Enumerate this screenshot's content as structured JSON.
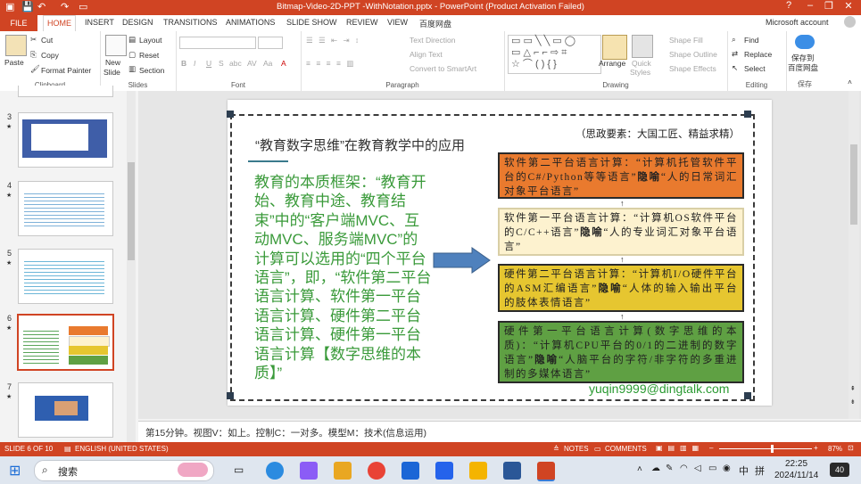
{
  "title_bar": {
    "document_title": "Bitmap-Video-2D-PPT -WithNotation.pptx - PowerPoint (Product Activation Failed)",
    "help": "?",
    "minimize": "–",
    "restore": "❐",
    "close": "✕"
  },
  "ribbon_tabs": [
    "FILE",
    "HOME",
    "INSERT",
    "DESIGN",
    "TRANSITIONS",
    "ANIMATIONS",
    "SLIDE SHOW",
    "REVIEW",
    "VIEW",
    "百度网盘"
  ],
  "account": "Microsoft account",
  "clipboard": {
    "paste": "Paste",
    "cut": "Cut",
    "copy": "Copy",
    "format_painter": "Format Painter",
    "label": "Clipboard"
  },
  "slides_group": {
    "new_slide": "New",
    "new_slide2": "Slide",
    "layout": "Layout",
    "reset": "Reset",
    "section": "Section",
    "label": "Slides"
  },
  "font_group": {
    "bold": "B",
    "italic": "I",
    "underline": "U",
    "strike": "S",
    "shadow": "abc",
    "spacing": "AV",
    "case": "Aa",
    "color": "A",
    "label": "Font"
  },
  "paragraph_group": {
    "text_direction": "Text Direction",
    "align_text": "Align Text",
    "smartart": "Convert to SmartArt",
    "label": "Paragraph"
  },
  "drawing_group": {
    "arrange": "Arrange",
    "quick": "Quick",
    "styles": "Styles",
    "shape_fill": "Shape Fill",
    "shape_outline": "Shape Outline",
    "shape_effects": "Shape Effects",
    "label": "Drawing"
  },
  "editing_group": {
    "find": "Find",
    "replace": "Replace",
    "select": "Select",
    "label": "Editing"
  },
  "save_group": {
    "line1": "保存到",
    "line2": "百度网盘",
    "label": "保存"
  },
  "thumbnails": [
    {
      "num": "3",
      "star": "★"
    },
    {
      "num": "4",
      "star": "★"
    },
    {
      "num": "5",
      "star": "★"
    },
    {
      "num": "6",
      "star": "★"
    },
    {
      "num": "7",
      "star": "★"
    }
  ],
  "slide": {
    "title": "“教育数字思维”在教育教学中的应用",
    "tag": "（思政要素：大国工匠、精益求精）",
    "main_text": "教育的本质框架：“教育开始、教育中途、教育结束”中的“客户端MVC、互动MVC、服务端MVC”的计算可以选用的“四个平台语言”，即，“软件第二平台语言计算、软件第一平台语言计算、硬件第二平台语言计算、硬件第一平台语言计算【数字思维的本质】”",
    "boxes": [
      {
        "prefix": "软件第二平台语言计算：“计算机托管软件平台的C#/Python等等语言”",
        "hidden": "隐喻",
        "suffix": "“人的日常词汇对象平台语言”"
      },
      {
        "prefix": "软件第一平台语言计算：“计算机OS软件平台的C/C++语言”",
        "hidden": "隐喻",
        "suffix": "“人的专业词汇对象平台语言”"
      },
      {
        "prefix": "硬件第二平台语言计算：“计算机I/O硬件平台的ASM汇编语言”",
        "hidden": "隐喻",
        "suffix": "“人体的输入输出平台的肢体表情语言”"
      },
      {
        "prefix": "硬件第一平台语言计算(数字思维的本质)：“计算机CPU平台的0/1的二进制的数字语言”",
        "hidden": "隐喻",
        "suffix": "“人脑平台的字符/非字符的多重进制的多媒体语言”"
      }
    ],
    "email": "yuqin9999@dingtalk.com",
    "colors": {
      "box1": "#e97a2e",
      "box2": "#fdf2cf",
      "box3": "#e6c630",
      "box4": "#5fa043",
      "main_text": "#3a9a3a",
      "arrow": "#4f81bd"
    }
  },
  "notes": "第15分钟。视图V：如上。控制C：一对多。模型M：技术(信息运用)",
  "status": {
    "slide_of": "SLIDE 6 OF 10",
    "language": "ENGLISH (UNITED STATES)",
    "notes_btn": "NOTES",
    "comments_btn": "COMMENTS",
    "zoom": "87%"
  },
  "taskbar": {
    "search": "搜索",
    "ime": "中",
    "ime2": "拼",
    "time": "22:25",
    "date": "2024/11/14",
    "badge": "40"
  }
}
